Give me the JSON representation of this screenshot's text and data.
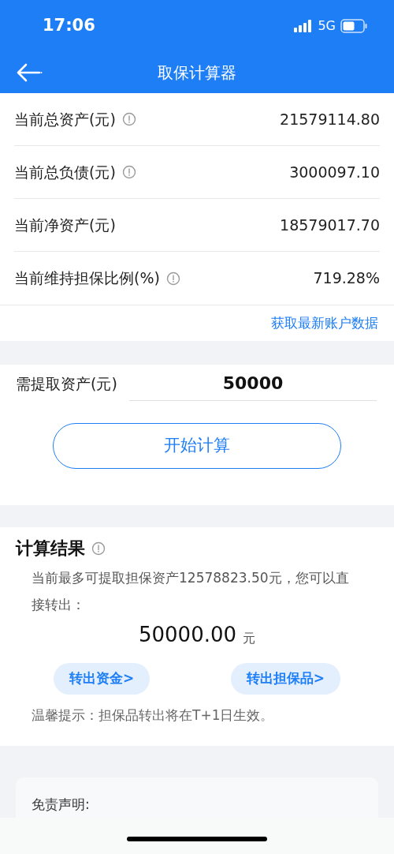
{
  "status_bar": {
    "time": "17:06",
    "network": "5G"
  },
  "nav": {
    "title": "取保计算器"
  },
  "info_rows": [
    {
      "label": "当前总资产(元)",
      "info": true,
      "value": "21579114.80"
    },
    {
      "label": "当前总负债(元)",
      "info": true,
      "value": "3000097.10"
    },
    {
      "label": "当前净资产(元)",
      "info": false,
      "value": "18579017.70"
    },
    {
      "label": "当前维持担保比例(%)",
      "info": true,
      "value": "719.28%"
    }
  ],
  "refresh_link": "获取最新账户数据",
  "withdraw": {
    "label": "需提取资产(元)",
    "value": "50000"
  },
  "calculate_button": "开始计算",
  "result": {
    "title": "计算结果",
    "message": "当前最多可提取担保资产12578823.50元，您可以直接转出：",
    "amount": "50000.00",
    "unit": "元",
    "buttons": [
      "转出资金>",
      "转出担保品>"
    ],
    "tip": "温馨提示：担保品转出将在T+1日生效。"
  },
  "disclaimer": {
    "title": "免责声明:"
  }
}
